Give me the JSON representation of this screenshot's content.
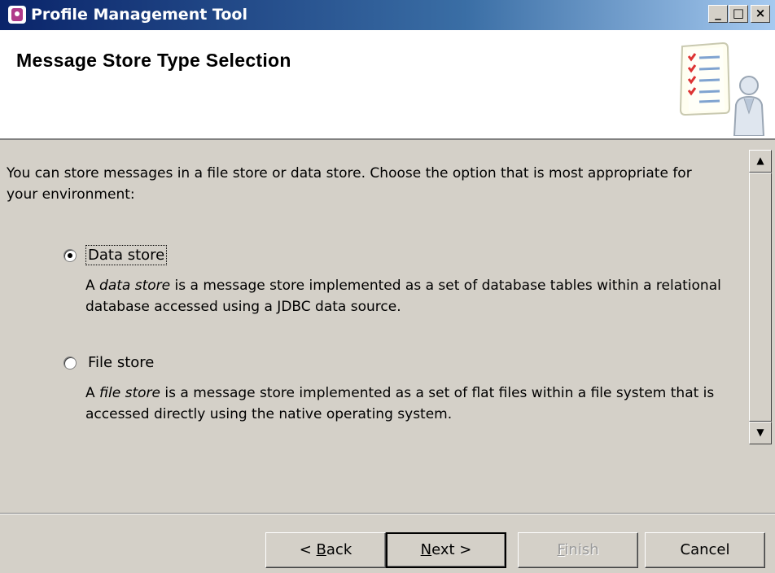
{
  "window": {
    "title": "Profile Management Tool",
    "controls": {
      "minimize": "_",
      "maximize": "□",
      "close": "×"
    }
  },
  "header": {
    "page_title": "Message Store Type Selection",
    "illustration_icon": "checklist-person-icon"
  },
  "content": {
    "intro": "You can store messages in a file store or data store. Choose the option that is most appropriate for your environment:",
    "options": [
      {
        "label": "Data store",
        "selected": true,
        "desc_prefix": "A ",
        "desc_term": "data store",
        "desc_suffix": " is a message store implemented as a set of database tables within a relational database accessed using a JDBC data source."
      },
      {
        "label": "File store",
        "selected": false,
        "desc_prefix": "A ",
        "desc_term": "file store",
        "desc_suffix": " is a message store implemented as a set of flat files within a file system that is accessed directly using the native operating system."
      }
    ]
  },
  "buttons": {
    "back_pre": "< ",
    "back_mnemonic": "B",
    "back_post": "ack",
    "next_mnemonic": "N",
    "next_post": "ext >",
    "finish_mnemonic": "F",
    "finish_post": "inish",
    "cancel": "Cancel"
  }
}
